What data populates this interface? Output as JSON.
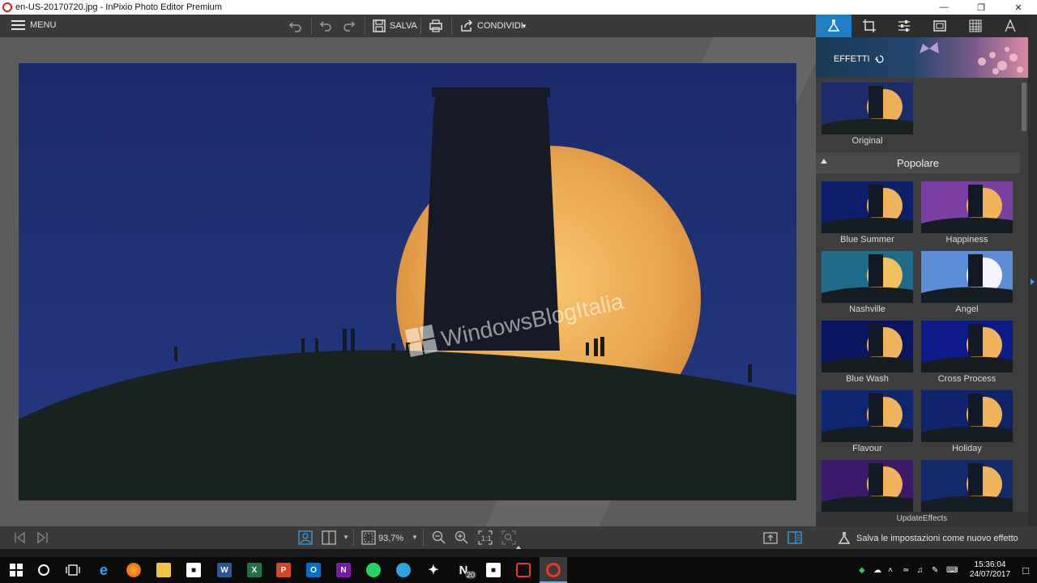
{
  "window": {
    "title": "en-US-20170720.jpg - InPixio Photo Editor Premium",
    "controls": [
      "minimize",
      "maximize",
      "close"
    ]
  },
  "toolbar": {
    "menu_label": "MENU",
    "save_label": "SALVA",
    "share_label": "CONDIVIDI"
  },
  "photo": {
    "watermark": "WindowsBlogItalia"
  },
  "panel": {
    "tabs": [
      "effects-icon",
      "crop-icon",
      "adjust-icon",
      "frame-icon",
      "texture-icon",
      "text-icon"
    ],
    "header_title": "EFFETTI",
    "original_label": "Original",
    "section_title": "Popolare",
    "effects": [
      {
        "label": "Blue Summer",
        "tint": "#0d1f6b"
      },
      {
        "label": "Happiness",
        "tint": "#7a3fa0"
      },
      {
        "label": "Nashville",
        "tint": "#1f6b8a"
      },
      {
        "label": "Angel",
        "tint": "#5c8ed6"
      },
      {
        "label": "Blue Wash",
        "tint": "#0a1560"
      },
      {
        "label": "Cross Process",
        "tint": "#0c1a8a"
      },
      {
        "label": "Flavour",
        "tint": "#0f2670"
      },
      {
        "label": "Holiday",
        "tint": "#10246e"
      },
      {
        "label": "",
        "tint": "#3b1a6a"
      },
      {
        "label": "",
        "tint": "#122a6a"
      }
    ],
    "update_label": "UpdateEffects"
  },
  "bottombar": {
    "zoom": "93,7%",
    "save_effect_label": "Salva le impostazioni come nuovo effetto"
  },
  "taskbar": {
    "time": "15:36:04",
    "date": "24/07/2017",
    "onenote_badge": "20",
    "apps": [
      "start",
      "search",
      "task-view",
      "edge",
      "firefox",
      "explorer",
      "store",
      "word",
      "excel",
      "powerpoint",
      "outlook",
      "onenote",
      "whatsapp",
      "telegram",
      "slack",
      "news",
      "network",
      "office",
      "inpixio"
    ]
  },
  "colors": {
    "accent": "#1e7fc7",
    "panel_bg": "#3d3d3d",
    "canvas_bg": "#5c5c5c",
    "sky": "#1f2f6e",
    "moon": "#f2b860"
  }
}
